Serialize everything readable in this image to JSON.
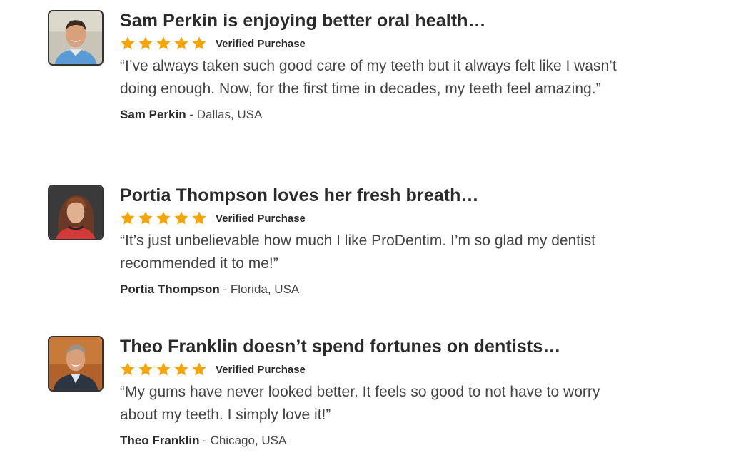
{
  "accent_color": "#f5a50a",
  "reviews": [
    {
      "headline": "Sam Perkin is enjoying better oral health…",
      "rating": 5,
      "verified": "Verified Purchase",
      "quote": "“I’ve always taken such good care of my teeth but it always felt like I wasn’t doing enough. Now, for the first time in decades, my teeth feel amazing.”",
      "name": "Sam Perkin",
      "location": " - Dallas, USA"
    },
    {
      "headline": "Portia Thompson loves her fresh breath…",
      "rating": 5,
      "verified": "Verified Purchase",
      "quote": "“It’s just unbelievable how much I like ProDentim. I’m so glad my dentist recommended it to me!”",
      "name": "Portia Thompson",
      "location": " - Florida, USA"
    },
    {
      "headline": "Theo Franklin doesn’t spend fortunes on dentists…",
      "rating": 5,
      "verified": "Verified Purchase",
      "quote": "“My gums have never looked better. It feels so good to not have to worry about my teeth. I simply love it!”",
      "name": "Theo Franklin",
      "location": " - Chicago, USA"
    }
  ]
}
